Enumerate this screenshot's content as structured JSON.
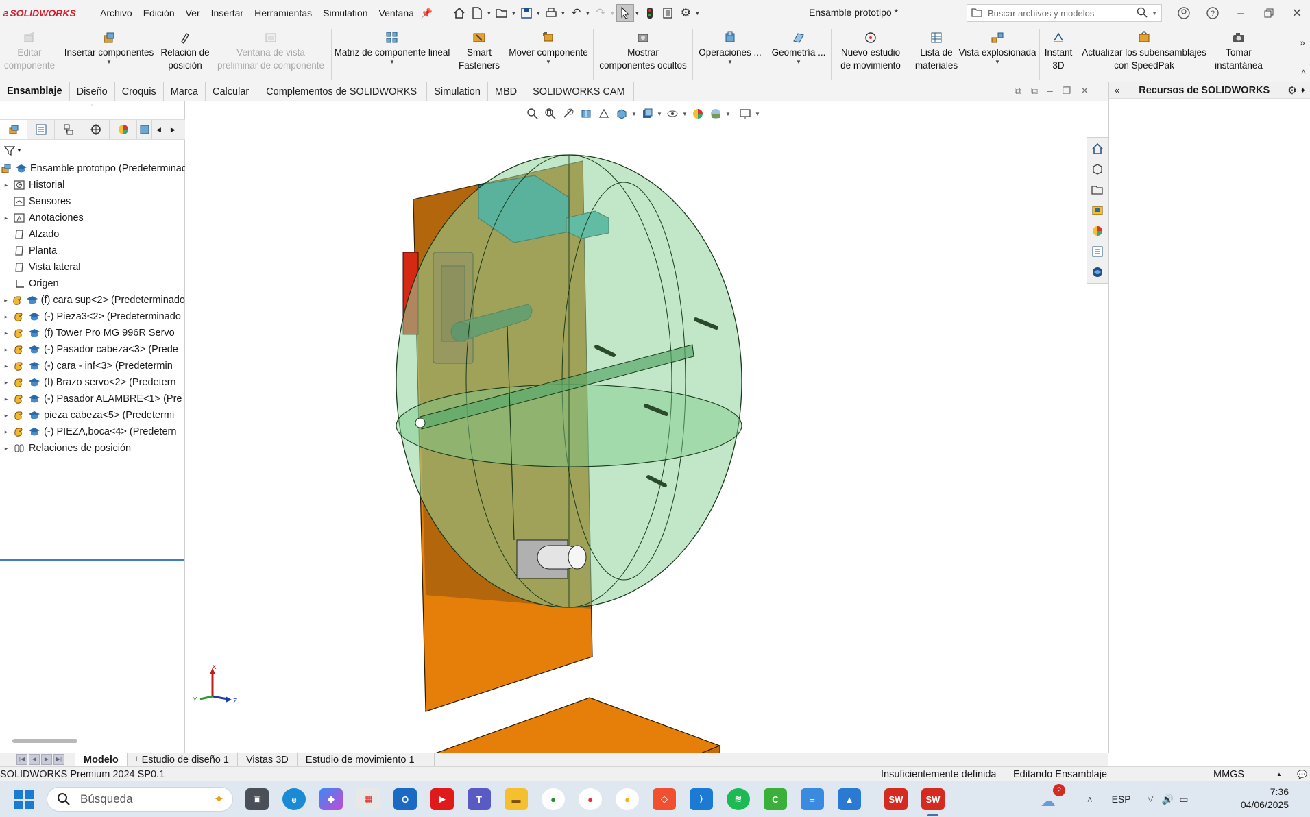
{
  "app": {
    "brand": "SOLIDWORKS",
    "document_title": "Ensamble prototipo *"
  },
  "menu": [
    "Archivo",
    "Edición",
    "Ver",
    "Insertar",
    "Herramientas",
    "Simulation",
    "Ventana"
  ],
  "search": {
    "placeholder": "Buscar archivos y modelos"
  },
  "commands": [
    {
      "label1": "Editar",
      "label2": "componente",
      "icon": "edit-component-icon",
      "disabled": true
    },
    {
      "label1": "Insertar componentes",
      "label2": "",
      "icon": "insert-components-icon",
      "disabled": false
    },
    {
      "label1": "Relación de",
      "label2": "posición",
      "icon": "mate-icon",
      "disabled": false
    },
    {
      "label1": "Ventana de vista",
      "label2": "preliminar de componente",
      "icon": "preview-window-icon",
      "disabled": true
    },
    {
      "label1": "Matriz de componente lineal",
      "label2": "",
      "icon": "linear-pattern-icon",
      "disabled": false
    },
    {
      "label1": "Smart",
      "label2": "Fasteners",
      "icon": "smart-fasteners-icon",
      "disabled": false
    },
    {
      "label1": "Mover componente",
      "label2": "",
      "icon": "move-component-icon",
      "disabled": false
    },
    {
      "label1": "Mostrar",
      "label2": "componentes ocultos",
      "icon": "show-hidden-icon",
      "disabled": false
    },
    {
      "label1": "Operaciones ...",
      "label2": "",
      "icon": "features-icon",
      "disabled": false
    },
    {
      "label1": "Geometría ...",
      "label2": "",
      "icon": "reference-geometry-icon",
      "disabled": false
    },
    {
      "label1": "Nuevo estudio",
      "label2": "de movimiento",
      "icon": "motion-study-icon",
      "disabled": false
    },
    {
      "label1": "Lista de",
      "label2": "materiales",
      "icon": "bom-icon",
      "disabled": false
    },
    {
      "label1": "Vista explosionada",
      "label2": "",
      "icon": "exploded-view-icon",
      "disabled": false
    },
    {
      "label1": "Instant",
      "label2": "3D",
      "icon": "instant3d-icon",
      "disabled": false
    },
    {
      "label1": "Actualizar los subensamblajes",
      "label2": "con SpeedPak",
      "icon": "speedpak-icon",
      "disabled": false
    },
    {
      "label1": "Tomar",
      "label2": "instantánea",
      "icon": "snapshot-icon",
      "disabled": false
    }
  ],
  "tabs": [
    "Ensamblaje",
    "Diseño",
    "Croquis",
    "Marca",
    "Calcular",
    "Complementos de SOLIDWORKS",
    "Simulation",
    "MBD",
    "SOLIDWORKS CAM"
  ],
  "tree": {
    "root": "Ensamble prototipo  (Predeterminado",
    "items": [
      {
        "label": "Historial",
        "kind": "history"
      },
      {
        "label": "Sensores",
        "kind": "sensor"
      },
      {
        "label": "Anotaciones",
        "kind": "annotation"
      },
      {
        "label": "Alzado",
        "kind": "plane"
      },
      {
        "label": "Planta",
        "kind": "plane"
      },
      {
        "label": "Vista lateral",
        "kind": "plane"
      },
      {
        "label": "Origen",
        "kind": "origin"
      },
      {
        "label": "(f) cara sup<2> (Predeterminado",
        "kind": "part"
      },
      {
        "label": "(-) Pieza3<2> (Predeterminado",
        "kind": "part"
      },
      {
        "label": "(f) Tower Pro MG 996R Servo",
        "kind": "part"
      },
      {
        "label": "(-) Pasador cabeza<3> (Prede",
        "kind": "part"
      },
      {
        "label": "(-) cara - inf<3> (Predetermin",
        "kind": "part"
      },
      {
        "label": "(f) Brazo servo<2> (Predetern",
        "kind": "part"
      },
      {
        "label": "(-) Pasador ALAMBRE<1> (Pre",
        "kind": "part"
      },
      {
        "label": "pieza cabeza<5> (Predetermi",
        "kind": "part"
      },
      {
        "label": "(-) PIEZA,boca<4> (Predetern",
        "kind": "part"
      },
      {
        "label": "Relaciones de posición",
        "kind": "mates"
      }
    ]
  },
  "task_pane": {
    "title": "Recursos de SOLIDWORKS"
  },
  "bottom_tabs": [
    "Modelo",
    "Estudio de diseño 1",
    "Vistas 3D",
    "Estudio de movimiento 1"
  ],
  "status": {
    "product": "SOLIDWORKS Premium 2024 SP0.1",
    "definition": "Insuficientemente definida",
    "mode": "Editando Ensamblaje",
    "units": "MMGS"
  },
  "triad": {
    "x": "X",
    "y": "Y",
    "z": "Z"
  },
  "taskbar": {
    "search_placeholder": "Búsqueda",
    "weather_badge": "2",
    "language": "ESP",
    "time": "7:36",
    "date": "04/06/2025"
  },
  "colors": {
    "accent": "#3b7dc4",
    "brand_red": "#d2202f",
    "base_orange": "#e67e0a",
    "sphere_green": "#8fd49a"
  }
}
